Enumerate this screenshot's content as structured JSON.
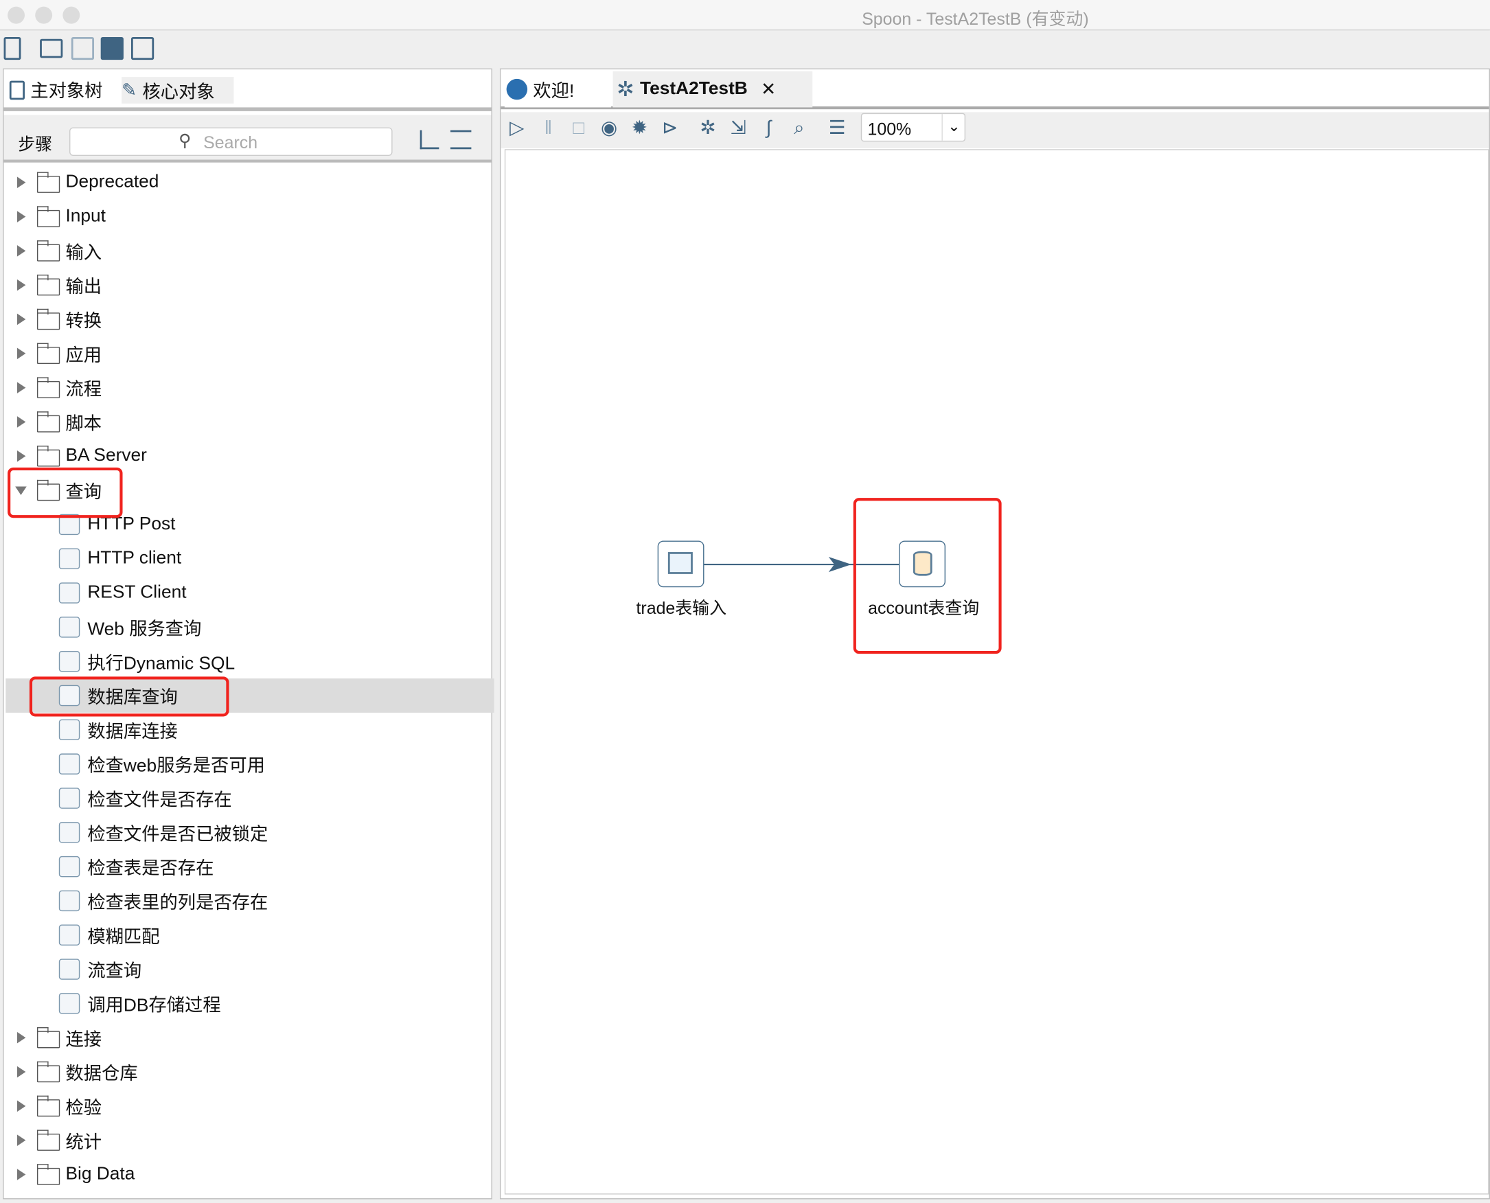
{
  "window": {
    "title": "Spoon - TestA2TestB (有变动)"
  },
  "left_tabs": [
    {
      "label": "主对象树",
      "icon": "object-tree-icon"
    },
    {
      "label": "核心对象",
      "icon": "pencil-icon"
    }
  ],
  "steps_label": "步骤",
  "search": {
    "placeholder": "Search",
    "value": ""
  },
  "tree": [
    {
      "label": "Deprecated",
      "type": "folder"
    },
    {
      "label": "Input",
      "type": "folder"
    },
    {
      "label": "输入",
      "type": "folder"
    },
    {
      "label": "输出",
      "type": "folder"
    },
    {
      "label": "转换",
      "type": "folder"
    },
    {
      "label": "应用",
      "type": "folder"
    },
    {
      "label": "流程",
      "type": "folder"
    },
    {
      "label": "脚本",
      "type": "folder"
    },
    {
      "label": "BA Server",
      "type": "folder"
    },
    {
      "label": "查询",
      "type": "folder",
      "expanded": true
    },
    {
      "label": "HTTP Post",
      "type": "step",
      "icon": "globe-icon"
    },
    {
      "label": "HTTP client",
      "type": "step",
      "icon": "globe-icon"
    },
    {
      "label": "REST Client",
      "type": "step",
      "icon": "globe-icon"
    },
    {
      "label": "Web 服务查询",
      "type": "step",
      "icon": "globe-search-icon"
    },
    {
      "label": "执行Dynamic SQL",
      "type": "step",
      "icon": "dynamic-sql-icon"
    },
    {
      "label": "数据库查询",
      "type": "step",
      "icon": "database-search-icon",
      "selected": true
    },
    {
      "label": "数据库连接",
      "type": "step",
      "icon": "database-join-icon"
    },
    {
      "label": "检查web服务是否可用",
      "type": "step",
      "icon": "globe-check-icon"
    },
    {
      "label": "检查文件是否存在",
      "type": "step",
      "icon": "file-check-icon"
    },
    {
      "label": "检查文件是否已被锁定",
      "type": "step",
      "icon": "file-lock-icon"
    },
    {
      "label": "检查表是否存在",
      "type": "step",
      "icon": "table-icon"
    },
    {
      "label": "检查表里的列是否存在",
      "type": "step",
      "icon": "table-column-check-icon"
    },
    {
      "label": "模糊匹配",
      "type": "step",
      "icon": "fuzzy-match-icon"
    },
    {
      "label": "流查询",
      "type": "step",
      "icon": "stream-lookup-icon"
    },
    {
      "label": "调用DB存储过程",
      "type": "step",
      "icon": "db-procedure-icon"
    },
    {
      "label": "连接",
      "type": "folder"
    },
    {
      "label": "数据仓库",
      "type": "folder"
    },
    {
      "label": "检验",
      "type": "folder"
    },
    {
      "label": "统计",
      "type": "folder"
    },
    {
      "label": "Big Data",
      "type": "folder"
    }
  ],
  "editor_tabs": [
    {
      "label": "欢迎!",
      "icon": "welcome-icon"
    },
    {
      "label": "TestA2TestB",
      "icon": "transformation-icon",
      "active": true,
      "closable": true
    }
  ],
  "zoom": {
    "value": "100%"
  },
  "canvas": {
    "nodes": [
      {
        "label": "trade表输入",
        "icon": "table-input-icon"
      },
      {
        "label": "account表查询",
        "icon": "database-lookup-icon"
      }
    ],
    "hop": {
      "from": "trade表输入",
      "to": "account表查询"
    }
  },
  "colors": {
    "accent": "#3f6482",
    "highlight": "#f0231e",
    "selected_row": "#dcdcdc"
  }
}
